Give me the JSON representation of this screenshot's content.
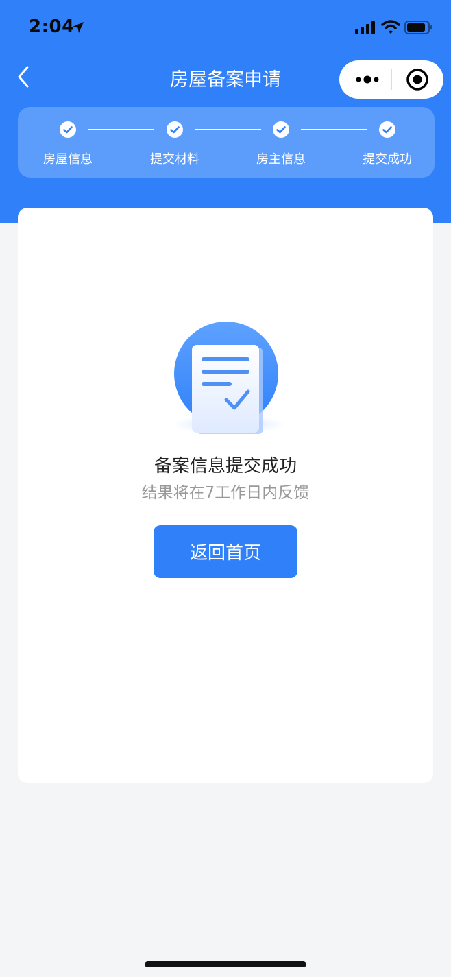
{
  "status_bar": {
    "time": "2:04"
  },
  "nav": {
    "title": "房屋备案申请"
  },
  "steps": [
    {
      "label": "房屋信息",
      "completed": true
    },
    {
      "label": "提交材料",
      "completed": true
    },
    {
      "label": "房主信息",
      "completed": true
    },
    {
      "label": "提交成功",
      "completed": true
    }
  ],
  "result": {
    "title": "备案信息提交成功",
    "subtitle": "结果将在7工作日内反馈",
    "button_label": "返回首页"
  },
  "colors": {
    "brand_blue": "#2f80f9",
    "page_background": "#f4f5f7"
  },
  "icons": {
    "location": "location-arrow-icon",
    "signal": "cellular-signal-icon",
    "wifi": "wifi-icon",
    "battery": "battery-icon",
    "back": "chevron-left-icon",
    "more": "more-dots-icon",
    "close_target": "target-icon",
    "step_done": "check-circle-icon",
    "illustration": "document-check-icon"
  }
}
